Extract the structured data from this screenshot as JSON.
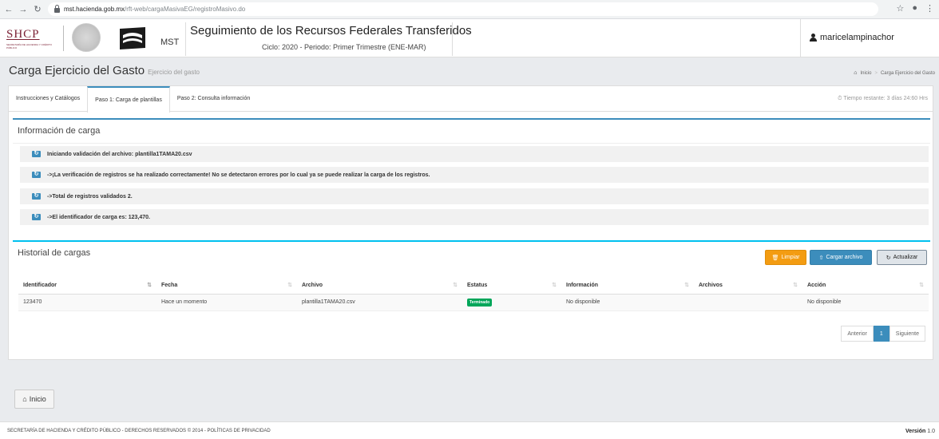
{
  "browser": {
    "url_host": "mst.hacienda.gob.mx",
    "url_path": "/rft-web/cargaMasivaEG/registroMasivo.do"
  },
  "header": {
    "shcp_title": "SHCP",
    "shcp_subtitle": "SECRETARÍA DE HACIENDA Y CRÉDITO PÚBLICO",
    "mst_label": "MST",
    "system_title": "Seguimiento de los Recursos Federales Transferidos",
    "system_subtitle": "Ciclo: 2020 - Periodo: Primer Trimestre (ENE-MAR)",
    "username": "maricelampinachor"
  },
  "page": {
    "title": "Carga Ejercicio del Gasto",
    "subtitle": "Ejercicio del gasto",
    "breadcrumb": [
      "Inicio",
      "Carga Ejercicio del Gasto"
    ]
  },
  "tabs": [
    {
      "label": "Instrucciones y Catálogos"
    },
    {
      "label": "Paso 1: Carga de plantillas"
    },
    {
      "label": "Paso 2: Consulta información"
    }
  ],
  "timer": "Tiempo restante: 3 días 24:60 Hrs",
  "info": {
    "title": "Información de carga",
    "messages": [
      "Iniciando validación del archivo: plantilla1TAMA20.csv",
      "->¡La verificación de registros se ha realizado correctamente! No se detectaron errores por lo cual ya se puede realizar la carga de los registros.",
      "->Total de registros validados 2.",
      "->El identificador de carga es: 123,470."
    ]
  },
  "history": {
    "title": "Historial de cargas",
    "buttons": {
      "clear": "Limpiar",
      "upload": "Cargar archivo",
      "refresh": "Actualizar"
    },
    "columns": [
      "Identificador",
      "Fecha",
      "Archivo",
      "Estatus",
      "Información",
      "Archivos",
      "Acción"
    ],
    "rows": [
      {
        "id": "123470",
        "fecha": "Hace un momento",
        "archivo": "plantilla1TAMA20.csv",
        "estatus": "Terminado",
        "informacion": "No disponible",
        "archivos": "",
        "accion": "No disponible"
      }
    ],
    "pager": {
      "prev": "Anterior",
      "current": "1",
      "next": "Siguiente"
    }
  },
  "inicio_button": "Inicio",
  "footer": {
    "left": "SECRETARÍA DE HACIENDA Y CRÉDITO PÚBLICO - DERECHOS RESERVADOS © 2014 - POLÍTICAS DE PRIVACIDAD",
    "version_label": "Versión",
    "version": "1.0"
  },
  "colors": {
    "primary": "#3c8dbc",
    "warning": "#f39c12",
    "success": "#00a65a",
    "brand": "#7a1f33"
  }
}
